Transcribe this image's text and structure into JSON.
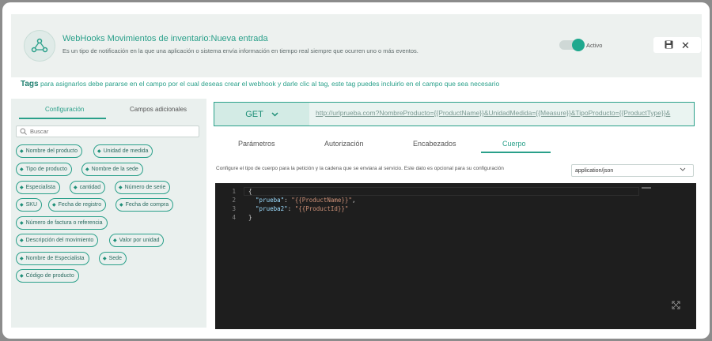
{
  "header": {
    "title": "WebHooks Movimientos de inventario:Nueva entrada",
    "subtitle": "Es un tipo de notificación en la que una aplicación o sistema envía información en tiempo real siempre que ocurren uno o más eventos.",
    "toggle_label": "Activo",
    "save_icon": "💾",
    "close_icon": "✕"
  },
  "tags_info": {
    "bold": "Tags",
    "text": " para asignarlos debe pararse en el campo por el cual deseas crear el webhook y darle clic al tag, este tag puedes incluirlo en el campo que sea necesario"
  },
  "left": {
    "tabs": [
      "Configuración",
      "Campos adicionales"
    ],
    "search_placeholder": "Buscar",
    "chips": [
      "Nombre del producto",
      "Unidad de medida",
      "Tipo de producto",
      "Nombre de la sede",
      "Especialista",
      "cantidad",
      "Número de serie",
      "SKU",
      "Fecha de registro",
      "Fecha de compra",
      "Número de factura o referencia",
      "Descripción del movimiento",
      "Valor por unidad",
      "Nombre de Especialista",
      "Sede",
      "Código de producto"
    ]
  },
  "request": {
    "method": "GET",
    "url": "http://urlprueba.com?NombreProducto={{ProductName}}&UnidadMedida={{Measure}}&TipoProducto={{ProductType}}&"
  },
  "tabs": [
    "Parámetros",
    "Autorización",
    "Encabezados",
    "Cuerpo"
  ],
  "body_config": {
    "description": "Configure el tipo de cuerpo para la petición y la cadena que se enviara al servicio. Este dato es opcional para su configuración",
    "content_type": "application/json"
  },
  "editor": {
    "line_numbers": [
      "1",
      "2",
      "3",
      "4"
    ],
    "lines": [
      "{",
      "  \"prueba\": \"{{ProductName}}\",",
      "  \"prueba2\": \"{{ProductId}}\"",
      "}"
    ],
    "open_brace": "{",
    "close_brace": "}",
    "key1": "\"prueba\"",
    "val1": "\"{{ProductName}}\"",
    "key2": "\"prueba2\"",
    "val2": "\"{{ProductId}}\""
  },
  "colors": {
    "accent": "#2aa08a",
    "editor_bg": "#1e1e1e"
  }
}
